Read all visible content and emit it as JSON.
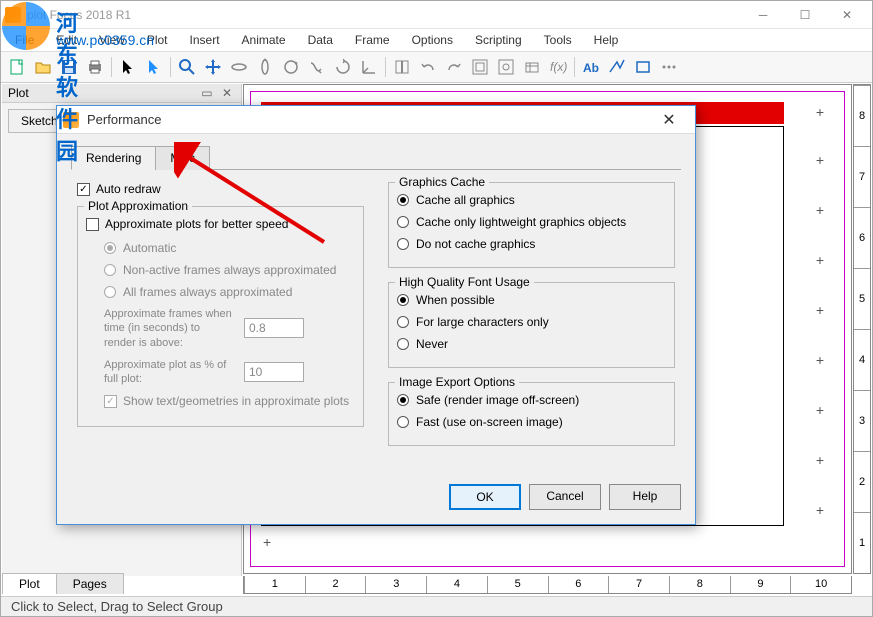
{
  "watermark": {
    "name": "河东软件园",
    "url": "www.pc0359.cn"
  },
  "main_title": "plot Focus 2018 R1",
  "menu": [
    "File",
    "Edit",
    "View",
    "Plot",
    "Insert",
    "Animate",
    "Data",
    "Frame",
    "Options",
    "Scripting",
    "Tools",
    "Help"
  ],
  "side": {
    "title": "Plot",
    "sketch": "Sketch"
  },
  "bottom_tabs": [
    "Plot",
    "Pages"
  ],
  "status": "Click to Select, Drag to Select Group",
  "ruler_x": [
    "1",
    "2",
    "3",
    "4",
    "5",
    "6",
    "7",
    "8",
    "9",
    "10"
  ],
  "ruler_y": [
    "8",
    "7",
    "6",
    "5",
    "4",
    "3",
    "2",
    "1"
  ],
  "dialog": {
    "title": "Performance",
    "tabs": [
      "Rendering",
      "Misc"
    ],
    "auto_redraw": "Auto redraw",
    "plot_approx": {
      "legend": "Plot Approximation",
      "approx_check": "Approximate plots for better speed",
      "r1": "Automatic",
      "r2": "Non-active frames always approximated",
      "r3": "All frames always approximated",
      "time_label": "Approximate frames when time (in seconds) to render is above:",
      "time_value": "0.8",
      "pct_label": "Approximate plot as % of full plot:",
      "pct_value": "10",
      "show_text": "Show text/geometries in approximate plots"
    },
    "graphics_cache": {
      "legend": "Graphics Cache",
      "r1": "Cache all graphics",
      "r2": "Cache only lightweight graphics objects",
      "r3": "Do not cache graphics"
    },
    "font_usage": {
      "legend": "High Quality Font Usage",
      "r1": "When possible",
      "r2": "For large characters only",
      "r3": "Never"
    },
    "image_export": {
      "legend": "Image Export Options",
      "r1": "Safe (render image off-screen)",
      "r2": "Fast (use on-screen image)"
    },
    "buttons": {
      "ok": "OK",
      "cancel": "Cancel",
      "help": "Help"
    }
  }
}
